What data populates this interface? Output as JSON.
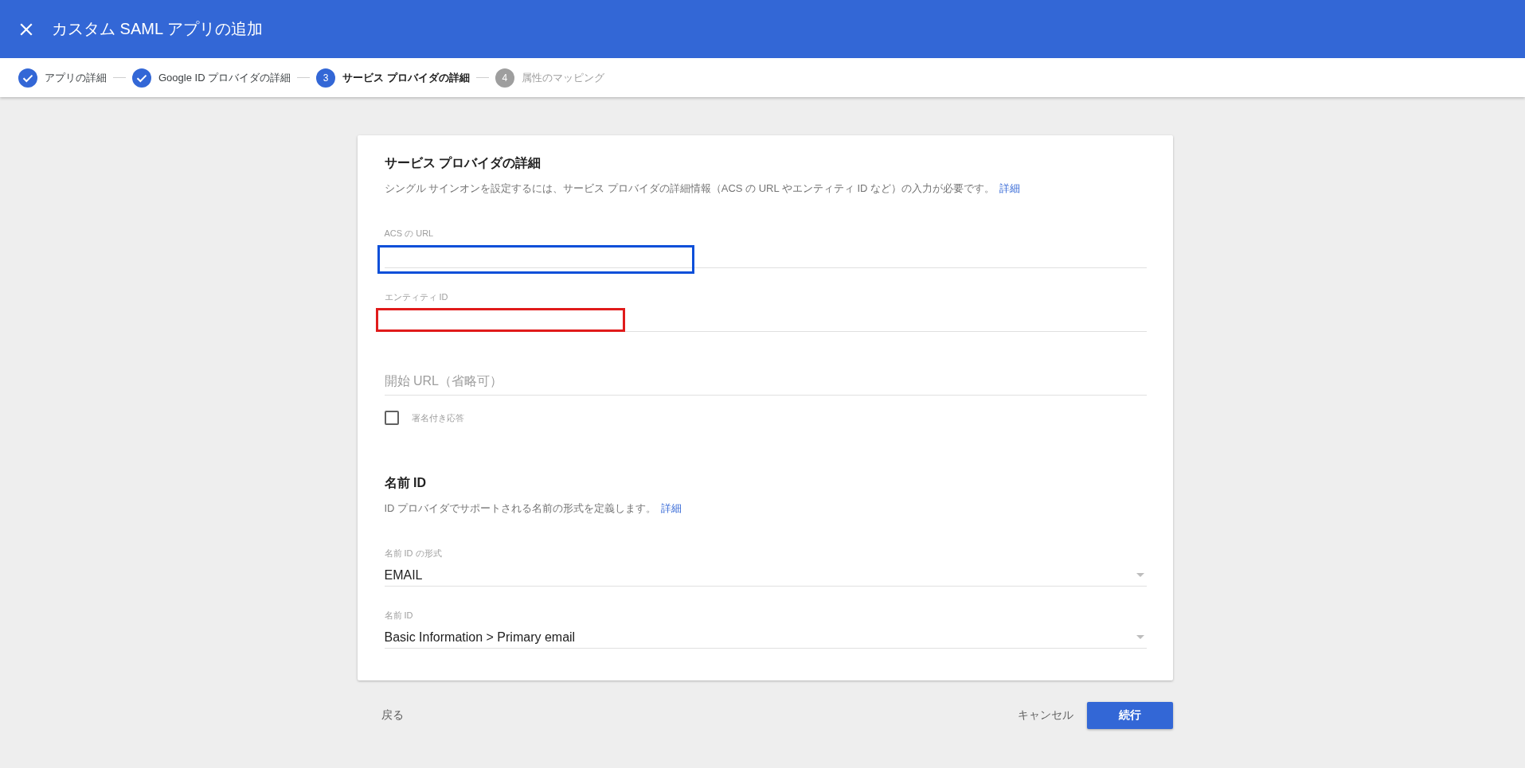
{
  "header": {
    "title": "カスタム SAML アプリの追加"
  },
  "stepper": [
    {
      "label": "アプリの詳細",
      "completed": true,
      "selected": false
    },
    {
      "label": "Google ID プロバイダの詳細",
      "completed": true,
      "selected": false
    },
    {
      "label": "サービス プロバイダの詳細",
      "number": "3",
      "completed": false,
      "selected": true
    },
    {
      "label": "属性のマッピング",
      "number": "4",
      "completed": false,
      "selected": false
    }
  ],
  "sections": [
    {
      "title": "サービス プロバイダの詳細",
      "description": "シングル サインオンを設定するには、サービス プロバイダの詳細情報（ACS の URL やエンティティ ID など）の入力が必要です。",
      "link": "詳細",
      "fields": [
        {
          "kind": "text",
          "label": "ACS の URL",
          "color": "#0b4fd9"
        },
        {
          "kind": "text",
          "label": "エンティティ ID",
          "color": "#e01b1b"
        },
        {
          "kind": "text",
          "placeholder": "開始 URL（省略可）"
        },
        {
          "kind": "checkbox",
          "label": "署名付き応答",
          "checked": false
        }
      ]
    },
    {
      "title": "名前 ID",
      "description": "ID プロバイダでサポートされる名前の形式を定義します。",
      "link": "詳細",
      "fields": [
        {
          "kind": "select",
          "label": "名前 ID の形式",
          "value": "EMAIL"
        },
        {
          "kind": "select",
          "label": "名前 ID",
          "value": "Basic Information > Primary email"
        }
      ]
    }
  ],
  "footer": {
    "back": "戻る",
    "cancel": "キャンセル",
    "continue": "続行"
  }
}
